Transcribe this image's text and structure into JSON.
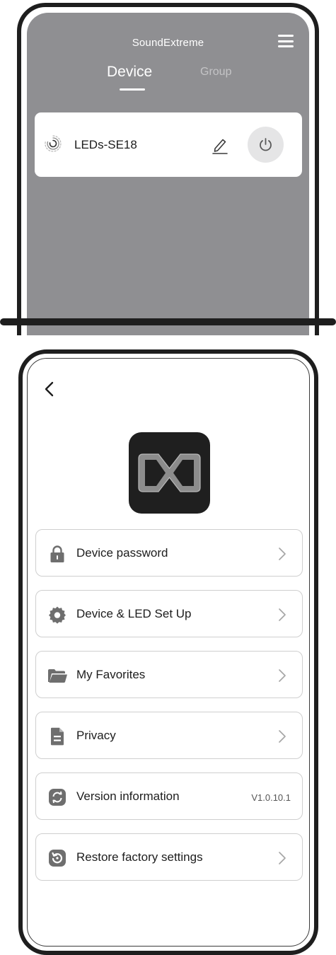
{
  "device_list": {
    "app_title": "SoundExtreme",
    "tabs": [
      {
        "label": "Device",
        "active": true
      },
      {
        "label": "Group",
        "active": false
      }
    ],
    "devices": [
      {
        "name": "LEDs-SE18"
      }
    ],
    "icons": {
      "menu": "hamburger-menu-icon",
      "device": "loading-spinner-icon",
      "edit": "pencil-icon",
      "power": "power-icon"
    }
  },
  "settings": {
    "icons": {
      "back": "chevron-left-icon",
      "logo": "brand-x-logo"
    },
    "items": [
      {
        "label": "Device password",
        "icon": "lock-icon",
        "trailing": "chevron"
      },
      {
        "label": "Device & LED Set Up",
        "icon": "gear-icon",
        "trailing": "chevron"
      },
      {
        "label": "My Favorites",
        "icon": "folder-icon",
        "trailing": "chevron"
      },
      {
        "label": "Privacy",
        "icon": "document-icon",
        "trailing": "chevron"
      },
      {
        "label": "Version information",
        "icon": "refresh-icon",
        "trailing": "text",
        "value": "V1.0.10.1"
      },
      {
        "label": "Restore factory settings",
        "icon": "restore-icon",
        "trailing": "chevron"
      }
    ]
  },
  "colors": {
    "header_bg": "#8f8f92",
    "frame": "#1e1e1e",
    "card": "#ffffff",
    "power_bg": "#e5e5e6",
    "icon_gray": "#6e6e6e"
  }
}
